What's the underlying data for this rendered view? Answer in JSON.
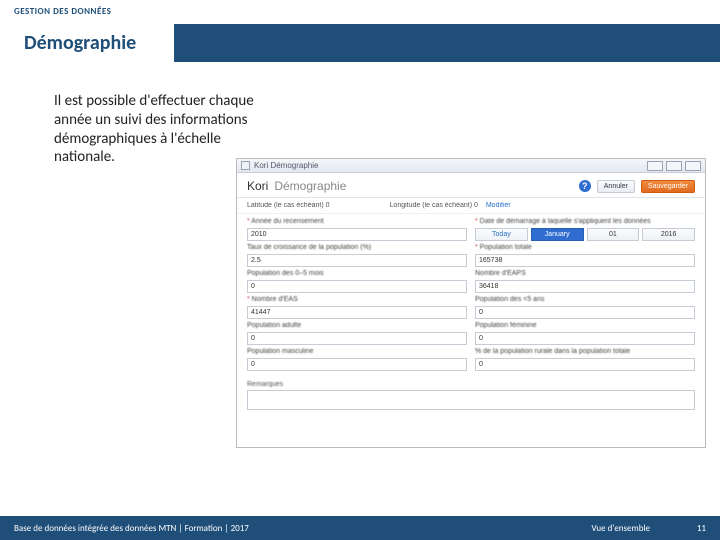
{
  "eyebrow": "GESTION DES DONNÉES",
  "title": "Démographie",
  "paragraph": "Il est possible d'effectuer chaque année un suivi des informations démographiques à l'échelle nationale.",
  "screenshot": {
    "window_title": "Kori Démographie",
    "breadcrumb_a": "Kori",
    "breadcrumb_b": "Démographie",
    "help_icon": "?",
    "btn_cancel": "Annuler",
    "btn_save": "Sauvegarder",
    "subrow": {
      "lat_label": "Latitude (le cas échéant)",
      "lat_value": "0",
      "lon_label": "Longitude (le cas échéant)",
      "lon_value": "0",
      "edit_link": "Modifier"
    },
    "left_col": {
      "year_label": "Année du recensement",
      "year_value": "2010",
      "growth_label": "Taux de croissance de la population (%)",
      "growth_value": "2.5",
      "pop05_label": "Population des 0–5 mois",
      "pop05_value": "0",
      "eas_label": "Nombre d'EAS",
      "eas_value": "41447",
      "adult_label": "Population adulte",
      "adult_value": "0",
      "male_label": "Population masculine",
      "male_value": "0"
    },
    "right_col": {
      "startdate_label": "Date de démarrage à laquelle s'appliquent les données",
      "date_today": "Today",
      "date_month": "January",
      "date_day": "01",
      "date_year": "2016",
      "poptotal_label": "Population totale",
      "poptotal_value": "165738",
      "eaps_label": "Nombre d'EAPS",
      "eaps_value": "36418",
      "popu5_label": "Population des <5 ans",
      "popu5_value": "0",
      "popf_label": "Population féminine",
      "popf_value": "0",
      "rural_label": "% de la population rurale dans la population totale",
      "rural_value": "0"
    },
    "remarks_label": "Remarques",
    "remarks_value": ""
  },
  "footer": {
    "left": "Base de données intégrée des données MTN | Formation | 2017",
    "section": "Vue d'ensemble",
    "page": "11"
  }
}
